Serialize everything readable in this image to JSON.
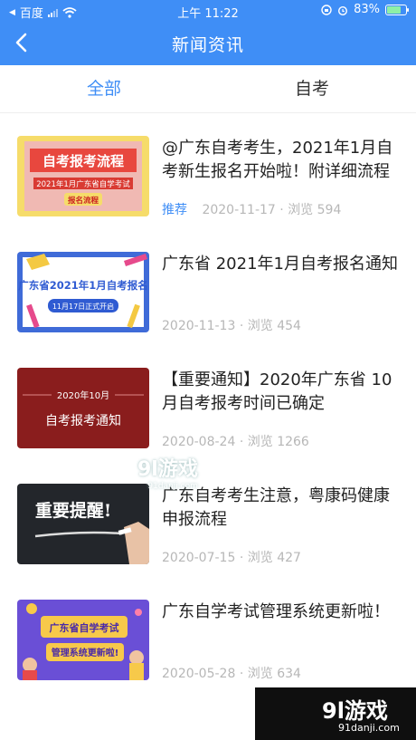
{
  "status": {
    "carrier": "百度",
    "time": "上午 11:22",
    "battery": "83%",
    "battery_level": 0.83
  },
  "nav": {
    "title": "新闻资讯"
  },
  "tabs": [
    {
      "label": "全部"
    },
    {
      "label": "自考"
    }
  ],
  "thumbs": {
    "t1": {
      "line1": "自考报考流程",
      "line2": "2021年1月广东省自学考试",
      "line3": "报名流程"
    },
    "t2": {
      "line1": "广东省2021年1月自考报名",
      "line2": "11月17日正式开启"
    },
    "t3": {
      "line1": "2020年10月",
      "line2": "自考报考通知"
    },
    "t4": {
      "line1": "重要提醒!"
    },
    "t5": {
      "line1": "广东省自学考试",
      "line2": "管理系统更新啦!"
    }
  },
  "news": [
    {
      "title": "@广东自考考生，2021年1月自考新生报名开始啦！附详细流程",
      "tag": "推荐",
      "date": "2020-11-17",
      "views_label": "浏览",
      "views": "594"
    },
    {
      "title": "广东省 2021年1月自考报名通知",
      "tag": "",
      "date": "2020-11-13",
      "views_label": "浏览",
      "views": "454"
    },
    {
      "title": "【重要通知】2020年广东省 10 月自考报考时间已确定",
      "tag": "",
      "date": "2020-08-24",
      "views_label": "浏览",
      "views": "1266"
    },
    {
      "title": "广东自考考生注意，粤康码健康申报流程",
      "tag": "",
      "date": "2020-07-15",
      "views_label": "浏览",
      "views": "427"
    },
    {
      "title": "广东自学考试管理系统更新啦！",
      "tag": "",
      "date": "2020-05-28",
      "views_label": "浏览",
      "views": "634"
    }
  ],
  "watermark": {
    "brand": "9l游戏",
    "site": "91danji.com"
  }
}
